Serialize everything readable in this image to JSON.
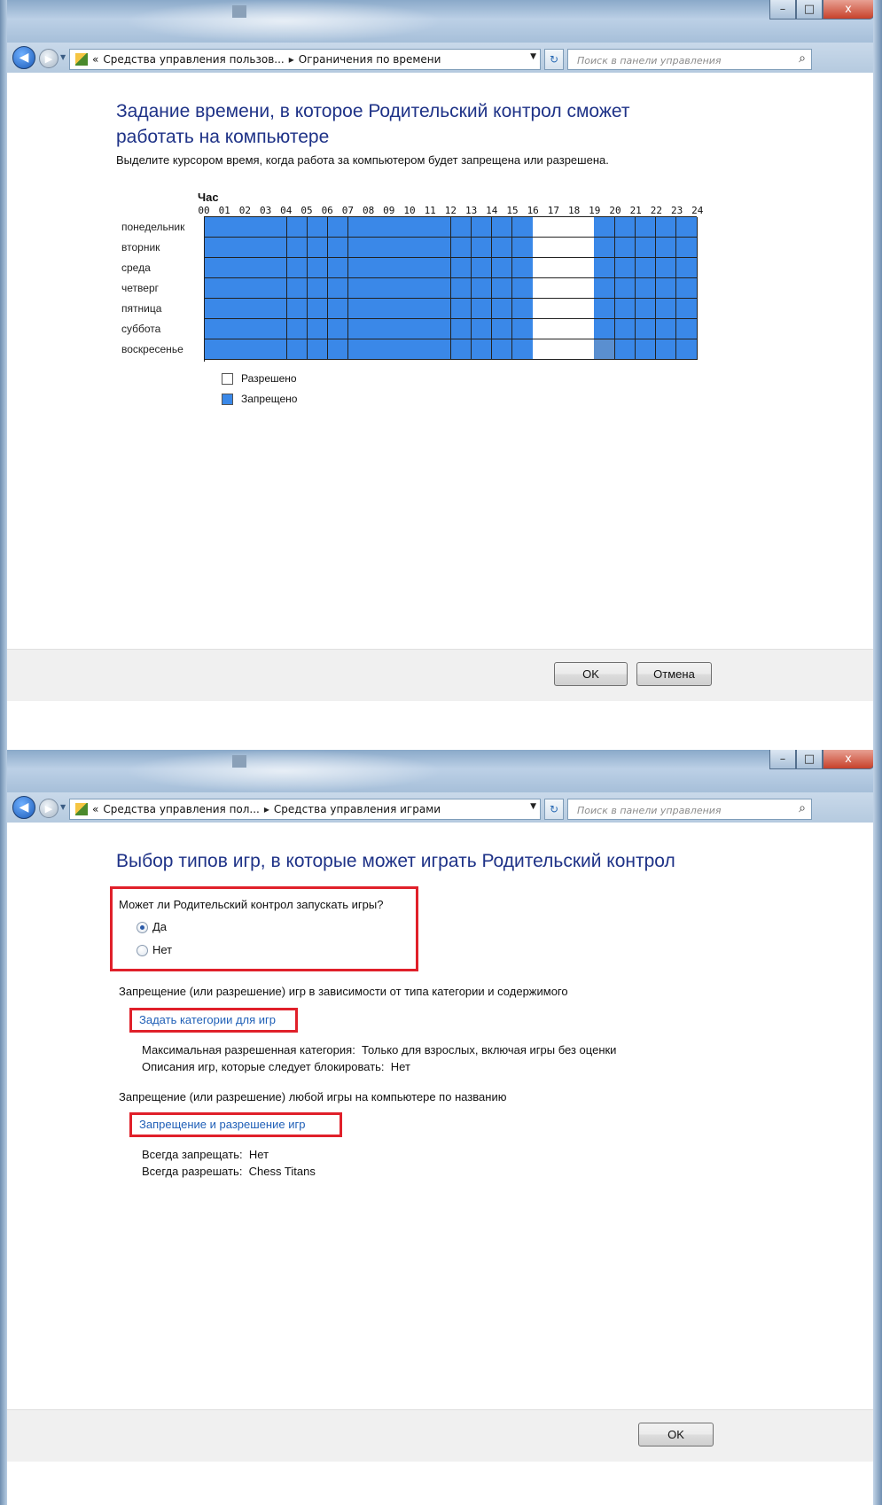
{
  "window1": {
    "title_buttons": {
      "minimize": "–",
      "maximize": "□",
      "close": "x"
    },
    "breadcrumb": {
      "prefix": "«",
      "items": [
        "Средства управления пользов...",
        "Ограничения по времени"
      ]
    },
    "search_placeholder": "Поиск в панели управления",
    "heading": "Задание времени, в которое Родительский контрол сможет работать на компьютере",
    "instruction": "Выделите курсором время, когда работа за компьютером будет запрещена или разрешена.",
    "hour_header": "Час",
    "hours": [
      "00",
      "01",
      "02",
      "03",
      "04",
      "05",
      "06",
      "07",
      "08",
      "09",
      "10",
      "11",
      "12",
      "13",
      "14",
      "15",
      "16",
      "17",
      "18",
      "19",
      "20",
      "21",
      "22",
      "23",
      "24"
    ],
    "days": [
      "понедельник",
      "вторник",
      "среда",
      "четверг",
      "пятница",
      "суббота",
      "воскресенье"
    ],
    "allowed_hours": [
      16,
      17,
      18
    ],
    "selected_cell": {
      "day": 6,
      "hour": 19
    },
    "legend": {
      "allowed": "Разрешено",
      "blocked": "Запрещено"
    },
    "colors": {
      "blocked": "#3a88e8",
      "allowed": "#ffffff",
      "heading": "#1e3287"
    },
    "ok_label": "OK",
    "cancel_label": "Отмена"
  },
  "window2": {
    "title_buttons": {
      "minimize": "–",
      "maximize": "□",
      "close": "x"
    },
    "breadcrumb": {
      "prefix": "«",
      "items": [
        "Средства управления пол...",
        "Средства управления играми"
      ]
    },
    "search_placeholder": "Поиск в панели управления",
    "heading": "Выбор типов игр, в которые может играть Родительский контрол",
    "question": "Может ли Родительский контрол запускать игры?",
    "radio_yes": "Да",
    "radio_no": "Нет",
    "selected": "yes",
    "section1": "Запрещение (или разрешение) игр в зависимости от типа категории и содержимого",
    "link_categories": "Задать категории для игр",
    "max_category_label": "Максимальная разрешенная категория:",
    "max_category_value": "Только для взрослых, включая игры без оценки",
    "descriptions_label": "Описания игр, которые следует блокировать:",
    "descriptions_value": "Нет",
    "section2": "Запрещение (или разрешение) любой игры на компьютере по названию",
    "link_games": "Запрещение и разрешение игр",
    "always_block_label": "Всегда запрещать:",
    "always_block_value": "Нет",
    "always_allow_label": "Всегда разрешать:",
    "always_allow_value": "Chess Titans",
    "highlight_color": "#e0202a",
    "ok_label": "OK"
  }
}
